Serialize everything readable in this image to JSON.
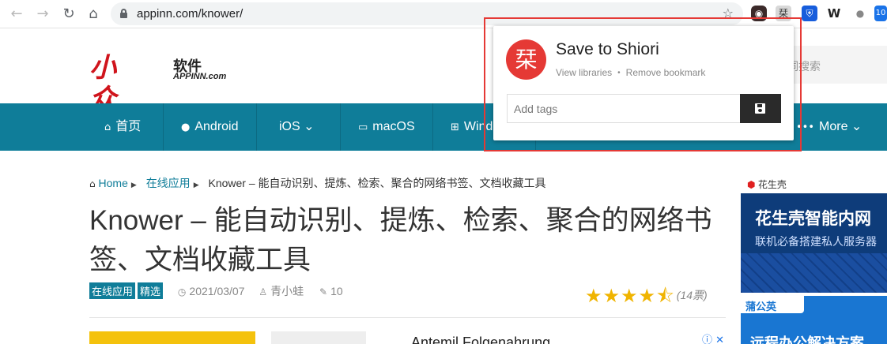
{
  "browser": {
    "url": "appinn.com/knower/",
    "back": "←",
    "forward": "→",
    "reload": "↻",
    "home": "⌂",
    "star": "☆",
    "extensions": [
      {
        "name": "camera-extension",
        "glyph": "◉"
      },
      {
        "name": "shiori-extension",
        "glyph": "栞"
      },
      {
        "name": "bitwarden-extension",
        "glyph": "⛨"
      },
      {
        "name": "w-extension",
        "glyph": "W"
      },
      {
        "name": "leaf-extension",
        "glyph": "●"
      },
      {
        "name": "badge-extension",
        "glyph": "10"
      }
    ]
  },
  "site": {
    "logo_mark": "小众",
    "logo_cn": "软件",
    "logo_en": "APPINN.com",
    "search_placeholder": "词搜索"
  },
  "nav": {
    "items": [
      {
        "icon": "⌂",
        "label": "首页"
      },
      {
        "icon": "●",
        "label": "Android"
      },
      {
        "icon": "",
        "label": "iOS ⌄"
      },
      {
        "icon": "▭",
        "label": "macOS"
      },
      {
        "icon": "⊞",
        "label": "Wind"
      },
      {
        "icon": "•••",
        "label": "More ⌄"
      }
    ]
  },
  "breadcrumb": {
    "home": "Home",
    "category": "在线应用",
    "current": "Knower – 能自动识别、提炼、检索、聚合的网络书签、文档收藏工具"
  },
  "article": {
    "title": "Knower – 能自动识别、提炼、检索、聚合的网络书签、文档收藏工具",
    "tags": [
      "在线应用",
      "精选"
    ],
    "date": "2021/03/07",
    "author": "青小蛙",
    "comments": "10",
    "stars": "★★★★⯪",
    "rating_count": "(14票)"
  },
  "ad_main": {
    "text": "Antemil Folgenahrung",
    "icons": "ⓘ ✕"
  },
  "ad_side1": {
    "brand_mark": "⬢",
    "brand": "花生壳",
    "headline": "花生壳智能内网",
    "subline": "联机必备搭建私人服务器"
  },
  "ad_side2": {
    "brand": "蒲公英",
    "headline": "远程办公解决方案"
  },
  "popup": {
    "logo": "栞",
    "title": "Save to Shiori",
    "link_libraries": "View libraries",
    "dot": "•",
    "link_remove": "Remove bookmark",
    "tags_placeholder": "Add tags"
  }
}
